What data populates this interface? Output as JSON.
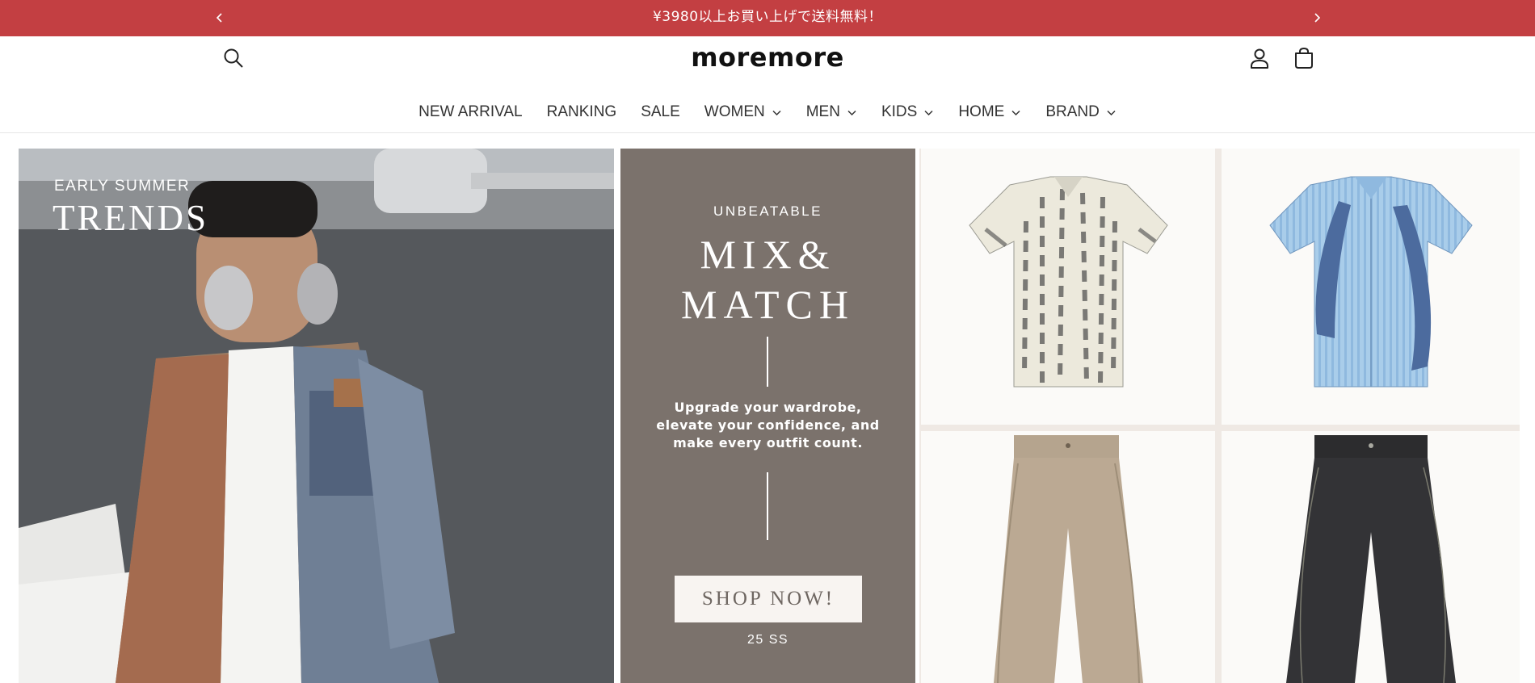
{
  "announcement": {
    "message": "¥3980以上お買い上げで送料無料！",
    "prev_icon": "chevron-left-icon",
    "next_icon": "chevron-right-icon",
    "background": "#c33f42"
  },
  "header": {
    "logo": "moremore",
    "icons": [
      "search-icon",
      "account-icon",
      "cart-icon"
    ]
  },
  "nav": {
    "items": [
      {
        "label": "NEW ARRIVAL",
        "dropdown": false
      },
      {
        "label": "RANKING",
        "dropdown": false
      },
      {
        "label": "SALE",
        "dropdown": false
      },
      {
        "label": "WOMEN",
        "dropdown": true
      },
      {
        "label": "MEN",
        "dropdown": true
      },
      {
        "label": "KIDS",
        "dropdown": true
      },
      {
        "label": "HOME",
        "dropdown": true
      },
      {
        "label": "BRAND",
        "dropdown": true
      }
    ]
  },
  "hero": {
    "photo": {
      "eyebrow": "EARLY SUMMER",
      "title": "TRENDS"
    },
    "promo": {
      "eyebrow": "UNBEATABLE",
      "title_line1": "MIX&",
      "title_line2": "MATCH",
      "body": "Upgrade your wardrobe, elevate your confidence, and make every outfit count.",
      "button": "SHOP NOW!",
      "sub": "25 SS",
      "background": "#7b726c"
    },
    "products": [
      "printed-shirt",
      "striped-blue-shirt",
      "beige-wide-pants",
      "dark-denim-pants"
    ]
  }
}
